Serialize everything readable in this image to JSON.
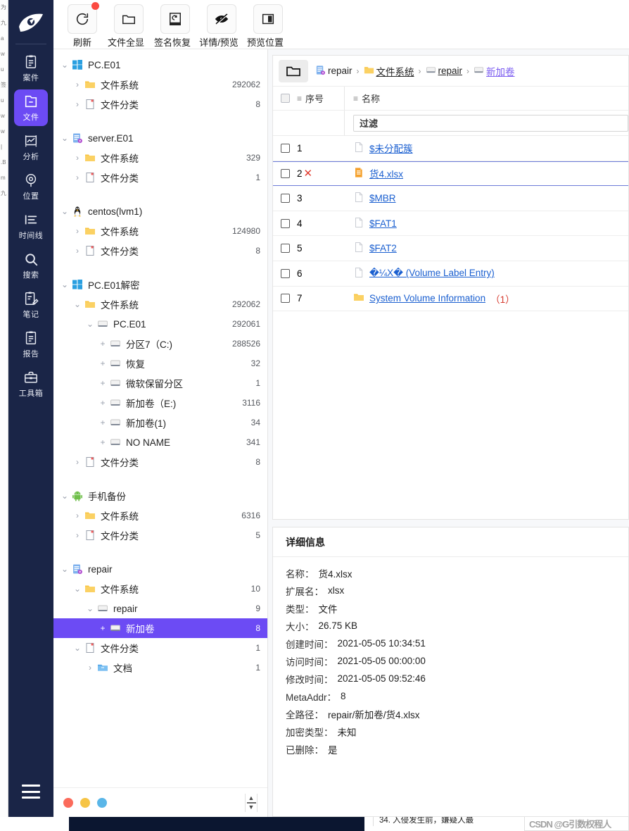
{
  "colors": {
    "nav_bg": "#1a2547",
    "accent": "#6c4bf4",
    "link": "#1a5fd0",
    "danger": "#e23b2e",
    "folder": "#f7c843"
  },
  "sidebar": {
    "logo_name": "app-logo",
    "items": [
      {
        "label": "案件",
        "icon": "case-icon",
        "active": false
      },
      {
        "label": "文件",
        "icon": "file-icon",
        "active": true
      },
      {
        "label": "分析",
        "icon": "analysis-icon",
        "active": false
      },
      {
        "label": "位置",
        "icon": "location-icon",
        "active": false
      },
      {
        "label": "时间线",
        "icon": "timeline-icon",
        "active": false
      },
      {
        "label": "搜索",
        "icon": "search-icon",
        "active": false
      },
      {
        "label": "笔记",
        "icon": "note-icon",
        "active": false
      },
      {
        "label": "报告",
        "icon": "report-icon",
        "active": false
      },
      {
        "label": "工具箱",
        "icon": "toolbox-icon",
        "active": false
      }
    ],
    "menu_toggle": "hamburger-icon"
  },
  "toolbar": {
    "buttons": [
      {
        "label": "刷新",
        "icon": "refresh-icon",
        "badge": true
      },
      {
        "label": "文件全显",
        "icon": "folder-icon",
        "badge": false
      },
      {
        "label": "签名恢复",
        "icon": "signature-restore-icon",
        "badge": false
      },
      {
        "label": "详情/预览",
        "icon": "eye-off-icon",
        "badge": false
      },
      {
        "label": "预览位置",
        "icon": "layout-panel-icon",
        "badge": false
      }
    ]
  },
  "tree": {
    "nodes": [
      {
        "depth": 0,
        "arrow": "v",
        "icon": "windows-icon",
        "label": "PC.E01",
        "count": ""
      },
      {
        "depth": 1,
        "arrow": ">",
        "icon": "folder-icon",
        "label": "文件系统",
        "count": "292062"
      },
      {
        "depth": 1,
        "arrow": ">",
        "icon": "doc-icon",
        "label": "文件分类",
        "count": "8"
      },
      {
        "depth": 0,
        "arrow": "",
        "icon": "",
        "label": "",
        "count": "",
        "spacer": true
      },
      {
        "depth": 0,
        "arrow": "v",
        "icon": "image-icon",
        "label": "server.E01",
        "count": ""
      },
      {
        "depth": 1,
        "arrow": ">",
        "icon": "folder-icon",
        "label": "文件系统",
        "count": "329"
      },
      {
        "depth": 1,
        "arrow": ">",
        "icon": "doc-icon",
        "label": "文件分类",
        "count": "1"
      },
      {
        "depth": 0,
        "arrow": "",
        "icon": "",
        "label": "",
        "count": "",
        "spacer": true
      },
      {
        "depth": 0,
        "arrow": "v",
        "icon": "linux-icon",
        "label": "centos(lvm1)",
        "count": ""
      },
      {
        "depth": 1,
        "arrow": ">",
        "icon": "folder-icon",
        "label": "文件系统",
        "count": "124980"
      },
      {
        "depth": 1,
        "arrow": ">",
        "icon": "doc-icon",
        "label": "文件分类",
        "count": "8"
      },
      {
        "depth": 0,
        "arrow": "",
        "icon": "",
        "label": "",
        "count": "",
        "spacer": true
      },
      {
        "depth": 0,
        "arrow": "v",
        "icon": "windows-icon",
        "label": "PC.E01解密",
        "count": ""
      },
      {
        "depth": 1,
        "arrow": "v",
        "icon": "folder-icon",
        "label": "文件系统",
        "count": "292062"
      },
      {
        "depth": 2,
        "arrow": "v",
        "icon": "disk-icon",
        "label": "PC.E01",
        "count": "292061"
      },
      {
        "depth": 3,
        "arrow": "+",
        "icon": "disk-icon",
        "label": "分区7（C:)",
        "count": "288526"
      },
      {
        "depth": 3,
        "arrow": "+",
        "icon": "disk-icon",
        "label": "恢复",
        "count": "32"
      },
      {
        "depth": 3,
        "arrow": "+",
        "icon": "disk-icon",
        "label": "微软保留分区",
        "count": "1"
      },
      {
        "depth": 3,
        "arrow": "+",
        "icon": "disk-icon",
        "label": "新加卷（E:)",
        "count": "3116"
      },
      {
        "depth": 3,
        "arrow": "+",
        "icon": "disk-icon",
        "label": "新加卷(1)",
        "count": "34"
      },
      {
        "depth": 3,
        "arrow": "+",
        "icon": "disk-icon",
        "label": "NO NAME",
        "count": "341"
      },
      {
        "depth": 1,
        "arrow": ">",
        "icon": "doc-icon",
        "label": "文件分类",
        "count": "8"
      },
      {
        "depth": 0,
        "arrow": "",
        "icon": "",
        "label": "",
        "count": "",
        "spacer": true
      },
      {
        "depth": 0,
        "arrow": "v",
        "icon": "android-icon",
        "label": "手机备份",
        "count": ""
      },
      {
        "depth": 1,
        "arrow": ">",
        "icon": "folder-icon",
        "label": "文件系统",
        "count": "6316"
      },
      {
        "depth": 1,
        "arrow": ">",
        "icon": "doc-icon",
        "label": "文件分类",
        "count": "5"
      },
      {
        "depth": 0,
        "arrow": "",
        "icon": "",
        "label": "",
        "count": "",
        "spacer": true
      },
      {
        "depth": 0,
        "arrow": "v",
        "icon": "image-icon",
        "label": "repair",
        "count": ""
      },
      {
        "depth": 1,
        "arrow": "v",
        "icon": "folder-icon",
        "label": "文件系统",
        "count": "10"
      },
      {
        "depth": 2,
        "arrow": "v",
        "icon": "disk-icon",
        "label": "repair",
        "count": "9"
      },
      {
        "depth": 3,
        "arrow": "+",
        "icon": "disk-icon",
        "label": "新加卷",
        "count": "8",
        "selected": true
      },
      {
        "depth": 1,
        "arrow": "v",
        "icon": "doc-icon",
        "label": "文件分类",
        "count": "1"
      },
      {
        "depth": 2,
        "arrow": ">",
        "icon": "docfolder-icon",
        "label": "文档",
        "count": "1"
      }
    ],
    "footer": {
      "dots": [
        "#fb6b5b",
        "#f6c445",
        "#5ab6e8"
      ],
      "split_control": "split-resize-handle"
    }
  },
  "breadcrumb": {
    "folder_button_icon": "folder-open-icon",
    "items": [
      {
        "label": "repair",
        "icon": "image-icon"
      },
      {
        "label": "文件系统",
        "icon": "folder-icon"
      },
      {
        "label": "repair",
        "icon": "disk-icon"
      },
      {
        "label": "新加卷",
        "icon": "disk-icon"
      }
    ],
    "separator": "›"
  },
  "filelist": {
    "columns": [
      {
        "key": "index",
        "label": "序号"
      },
      {
        "key": "name",
        "label": "名称"
      }
    ],
    "filter_placeholder": "过滤",
    "filter_value": "过滤",
    "rows": [
      {
        "index": "1",
        "name": "$未分配簇",
        "icon": "file-icon",
        "deleted": false,
        "current": false,
        "suffix": ""
      },
      {
        "index": "2",
        "name": "货4.xlsx",
        "icon": "excel-icon",
        "deleted": true,
        "current": true,
        "suffix": ""
      },
      {
        "index": "3",
        "name": "$MBR",
        "icon": "file-icon",
        "deleted": false,
        "current": false,
        "suffix": ""
      },
      {
        "index": "4",
        "name": "$FAT1",
        "icon": "file-icon",
        "deleted": false,
        "current": false,
        "suffix": ""
      },
      {
        "index": "5",
        "name": "$FAT2",
        "icon": "file-icon",
        "deleted": false,
        "current": false,
        "suffix": ""
      },
      {
        "index": "6",
        "name": "�¼X� (Volume Label Entry)",
        "icon": "file-icon",
        "deleted": false,
        "current": false,
        "suffix": ""
      },
      {
        "index": "7",
        "name": "System Volume Information",
        "icon": "folder-icon",
        "deleted": false,
        "current": false,
        "suffix": "（1）"
      }
    ]
  },
  "details": {
    "title": "详细信息",
    "fields": [
      {
        "key": "名称：",
        "value": "货4.xlsx"
      },
      {
        "key": "扩展名：",
        "value": "xlsx"
      },
      {
        "key": "类型：",
        "value": "文件"
      },
      {
        "key": "大小：",
        "value": "26.75 KB"
      },
      {
        "key": "创建时间：",
        "value": "2021-05-05 10:34:51"
      },
      {
        "key": "访问时间：",
        "value": "2021-05-05 00:00:00"
      },
      {
        "key": "修改时间：",
        "value": "2021-05-05 09:52:46"
      },
      {
        "key": "MetaAddr：",
        "value": "8"
      },
      {
        "key": "全路径：",
        "value": "repair/新加卷/货4.xlsx"
      },
      {
        "key": "加密类型：",
        "value": "未知"
      },
      {
        "key": "已删除：",
        "value": "是"
      }
    ]
  },
  "background": {
    "snippet": "34. 入侵发生前，嫌疑人最",
    "watermark": "CSDN @G引数权程人",
    "sliver_lines": [
      "为",
      "九",
      "a",
      "w",
      "u",
      "签",
      "u",
      "w",
      "w",
      "|",
      ".B",
      "m",
      "九"
    ]
  }
}
